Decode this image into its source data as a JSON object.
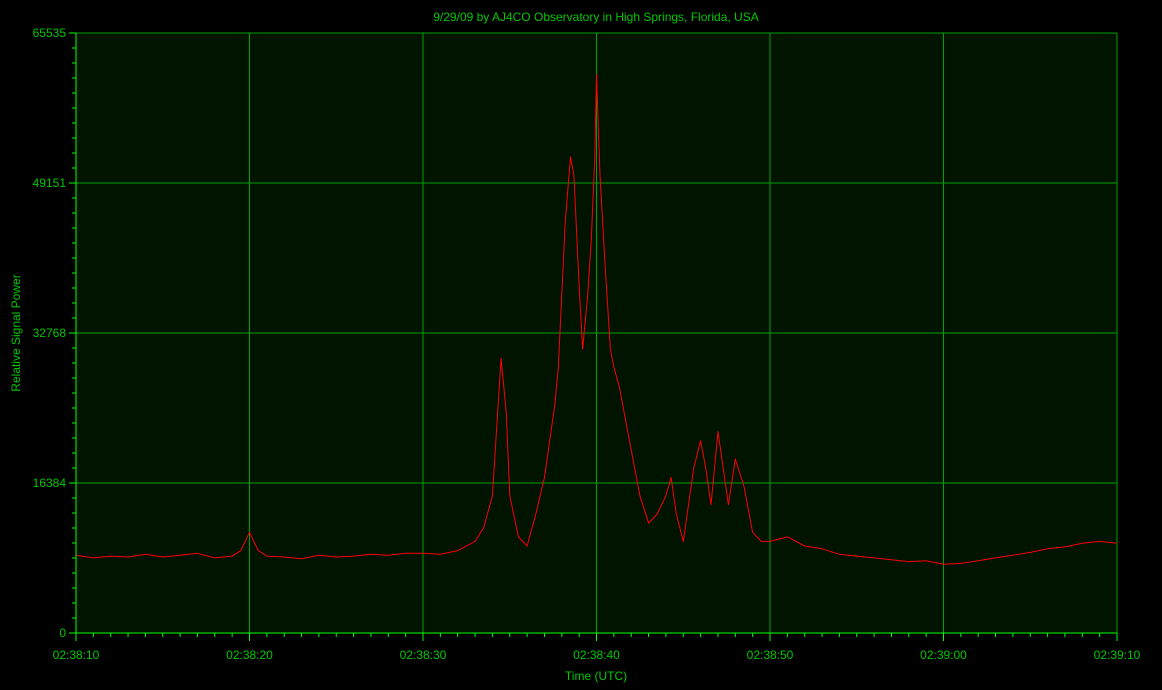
{
  "chart_data": {
    "type": "line",
    "title": "9/29/09  by  AJ4CO Observatory  in  High Springs, Florida, USA",
    "xlabel": "Time (UTC)",
    "ylabel": "Relative Signal Power",
    "xlim": [
      "02:38:10",
      "02:39:10"
    ],
    "ylim": [
      0,
      65535
    ],
    "yticks": [
      0,
      16384,
      32768,
      49151,
      65535
    ],
    "xticks": [
      "02:38:10",
      "02:38:20",
      "02:38:30",
      "02:38:40",
      "02:38:50",
      "02:39:00",
      "02:39:10"
    ],
    "grid": true,
    "legend": "none",
    "colors": {
      "background": "#000000",
      "plot_area": "#001400",
      "grid": "#00a000",
      "axis_text": "#00c800",
      "series": "#ff0000",
      "axis_line": "#00ff00"
    },
    "series": [
      {
        "color": "#ff0000",
        "x": [
          "02:38:10",
          "02:38:11",
          "02:38:12",
          "02:38:13",
          "02:38:14",
          "02:38:15",
          "02:38:16",
          "02:38:17",
          "02:38:18",
          "02:38:19",
          "02:38:19.5",
          "02:38:20",
          "02:38:20.5",
          "02:38:21",
          "02:38:22",
          "02:38:23",
          "02:38:24",
          "02:38:25",
          "02:38:26",
          "02:38:27",
          "02:38:28",
          "02:38:29",
          "02:38:30",
          "02:38:31",
          "02:38:32",
          "02:38:33",
          "02:38:33.5",
          "02:38:34",
          "02:38:34.3",
          "02:38:34.5",
          "02:38:34.8",
          "02:38:35",
          "02:38:35.5",
          "02:38:36",
          "02:38:36.5",
          "02:38:37",
          "02:38:37.3",
          "02:38:37.6",
          "02:38:37.8",
          "02:38:38",
          "02:38:38.2",
          "02:38:38.5",
          "02:38:38.7",
          "02:38:39",
          "02:38:39.2",
          "02:38:39.5",
          "02:38:39.7",
          "02:38:39.9",
          "02:38:40",
          "02:38:40.2",
          "02:38:40.5",
          "02:38:40.8",
          "02:38:41",
          "02:38:41.3",
          "02:38:41.6",
          "02:38:42",
          "02:38:42.5",
          "02:38:43",
          "02:38:43.5",
          "02:38:44",
          "02:38:44.3",
          "02:38:44.6",
          "02:38:45",
          "02:38:45.3",
          "02:38:45.6",
          "02:38:46",
          "02:38:46.3",
          "02:38:46.6",
          "02:38:47",
          "02:38:47.3",
          "02:38:47.6",
          "02:38:48",
          "02:38:48.5",
          "02:38:49",
          "02:38:49.5",
          "02:38:50",
          "02:38:51",
          "02:38:52",
          "02:38:53",
          "02:38:54",
          "02:38:55",
          "02:38:56",
          "02:38:57",
          "02:38:58",
          "02:38:59",
          "02:39:00",
          "02:39:01",
          "02:39:02",
          "02:39:03",
          "02:39:04",
          "02:39:05",
          "02:39:06",
          "02:39:07",
          "02:39:08",
          "02:39:09",
          "02:39:10"
        ],
        "y": [
          8500,
          8200,
          8400,
          8300,
          8600,
          8300,
          8500,
          8700,
          8200,
          8400,
          9000,
          11000,
          9000,
          8400,
          8300,
          8100,
          8500,
          8300,
          8400,
          8600,
          8500,
          8700,
          8700,
          8600,
          9000,
          10000,
          11500,
          15000,
          24000,
          30000,
          24000,
          15000,
          10500,
          9500,
          13000,
          17000,
          21000,
          25000,
          29000,
          37000,
          45000,
          52000,
          50000,
          38000,
          31000,
          37000,
          43000,
          52000,
          61000,
          50000,
          40000,
          31000,
          29000,
          27000,
          24000,
          20000,
          15000,
          12000,
          13000,
          15000,
          17000,
          13000,
          10000,
          14000,
          18000,
          21000,
          18000,
          14000,
          22000,
          18000,
          14000,
          19000,
          16000,
          11000,
          10000,
          10000,
          10500,
          9500,
          9200,
          8600,
          8400,
          8200,
          8000,
          7800,
          7900,
          7500,
          7600,
          7900,
          8200,
          8500,
          8800,
          9200,
          9400,
          9800,
          10000,
          9800
        ]
      }
    ]
  }
}
